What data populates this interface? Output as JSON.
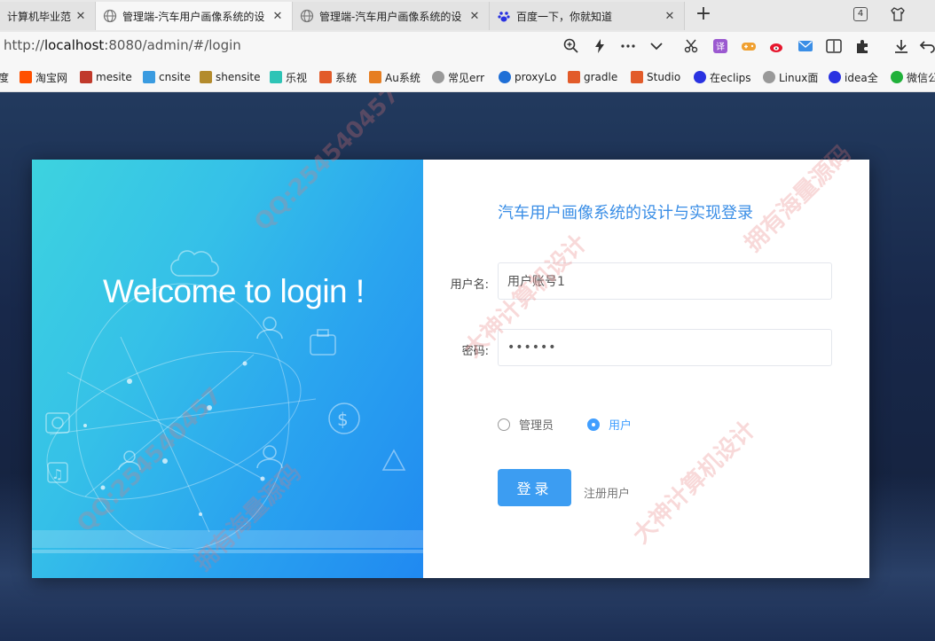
{
  "browser": {
    "tabs": [
      {
        "title": "计算机毕业范",
        "active": false
      },
      {
        "title": "管理端-汽车用户画像系统的设",
        "active": true
      },
      {
        "title": "管理端-汽车用户画像系统的设",
        "active": false
      },
      {
        "title": "百度一下，你就知道",
        "active": false
      }
    ],
    "tab_count": "4",
    "url_prefix": "http://",
    "url_host": "localhost",
    "url_rest": ":8080/admin/#/login",
    "bookmarks": [
      {
        "label": "度",
        "icon_color": "#888888"
      },
      {
        "label": "淘宝网",
        "icon_color": "#ff5000"
      },
      {
        "label": "mesite",
        "icon_color": "#c0392b"
      },
      {
        "label": "cnsite",
        "icon_color": "#3a9be0"
      },
      {
        "label": "shensite",
        "icon_color": "#b38b2d"
      },
      {
        "label": "乐视",
        "icon_color": "#2ec4b6"
      },
      {
        "label": "系统",
        "icon_color": "#e25b2a"
      },
      {
        "label": "Au系统",
        "icon_color": "#e67e22"
      },
      {
        "label": "常见err",
        "icon_color": "#999999"
      },
      {
        "label": "proxyLo",
        "icon_color": "#1f6fd6"
      },
      {
        "label": "gradle",
        "icon_color": "#e25b2a"
      },
      {
        "label": "Studio",
        "icon_color": "#e25b2a"
      },
      {
        "label": "在eclips",
        "icon_color": "#2932e1"
      },
      {
        "label": "Linux面",
        "icon_color": "#999999"
      },
      {
        "label": "idea全",
        "icon_color": "#2932e1"
      },
      {
        "label": "微信公",
        "icon_color": "#20b13a"
      }
    ]
  },
  "login": {
    "welcome": "Welcome to login !",
    "title": "汽车用户画像系统的设计与实现登录",
    "username_label": "用户名:",
    "username_value": "用户账号1",
    "password_label": "密码:",
    "password_value": "••••••",
    "roles": [
      {
        "label": "管理员",
        "checked": false
      },
      {
        "label": "用户",
        "checked": true
      }
    ],
    "login_button": "登录",
    "register_link": "注册用户"
  },
  "colors": {
    "accent": "#409eff",
    "button": "#3c9df2",
    "title": "#3a8ee6",
    "panel_gradient_start": "#3dd3df",
    "panel_gradient_end": "#2089f1"
  },
  "watermarks": [
    "QQ:254540457",
    "大神计算机设计",
    "拥有海量源码"
  ]
}
